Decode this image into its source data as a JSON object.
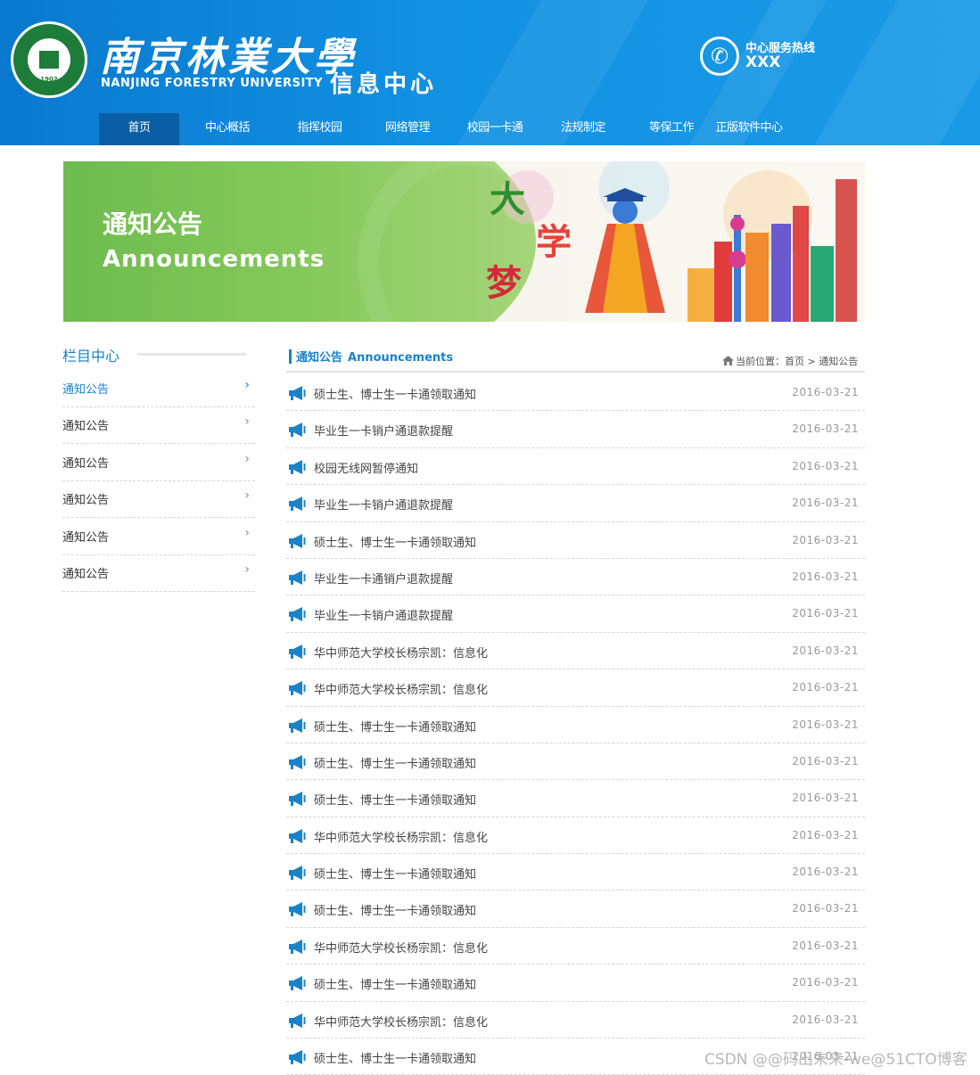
{
  "header": {
    "university_cn": "南京林業大學",
    "university_en": "NANJING FORESTRY UNIVERSITY",
    "seal_year": "1902",
    "center_title": "信息中心",
    "hotline_label": "中心服务热线",
    "hotline_number": "XXX",
    "brand_color": "#0a79cf"
  },
  "nav": {
    "items": [
      {
        "label": "首页",
        "active": true
      },
      {
        "label": "中心概括"
      },
      {
        "label": "指挥校园"
      },
      {
        "label": "网络管理"
      },
      {
        "label": "校园一卡通"
      },
      {
        "label": "法规制定"
      },
      {
        "label": "等保工作"
      },
      {
        "label": "正版软件中心"
      }
    ]
  },
  "banner": {
    "title": "通知公告",
    "subtitle": "Announcements",
    "art_text": [
      "大",
      "学",
      "梦"
    ]
  },
  "sidebar": {
    "title": "栏目中心",
    "items": [
      {
        "label": "通知公告",
        "active": true
      },
      {
        "label": "通知公告"
      },
      {
        "label": "通知公告"
      },
      {
        "label": "通知公告"
      },
      {
        "label": "通知公告"
      },
      {
        "label": "通知公告"
      }
    ],
    "chevron": "›"
  },
  "main": {
    "section_title": "通知公告",
    "section_title_en": "Announcements",
    "breadcrumb": "当前位置：首页 > 通知公告",
    "items": [
      {
        "title": "硕士生、博士生一卡通领取通知",
        "date": "2016-03-21"
      },
      {
        "title": "毕业生一卡销户通退款提醒",
        "date": "2016-03-21"
      },
      {
        "title": "校园无线网暂停通知",
        "date": "2016-03-21"
      },
      {
        "title": "毕业生一卡销户通退款提醒",
        "date": "2016-03-21"
      },
      {
        "title": "硕士生、博士生一卡通领取通知",
        "date": "2016-03-21"
      },
      {
        "title": "毕业生一卡通销户退款提醒",
        "date": "2016-03-21"
      },
      {
        "title": "毕业生一卡销户通退款提醒",
        "date": "2016-03-21"
      },
      {
        "title": "华中师范大学校长杨宗凯：信息化",
        "date": "2016-03-21"
      },
      {
        "title": "华中师范大学校长杨宗凯：信息化",
        "date": "2016-03-21"
      },
      {
        "title": "硕士生、博士生一卡通领取通知",
        "date": "2016-03-21"
      },
      {
        "title": "硕士生、博士生一卡通领取通知",
        "date": "2016-03-21"
      },
      {
        "title": "硕士生、博士生一卡通领取通知",
        "date": "2016-03-21"
      },
      {
        "title": "华中师范大学校长杨宗凯：信息化",
        "date": "2016-03-21"
      },
      {
        "title": "硕士生、博士生一卡通领取通知",
        "date": "2016-03-21"
      },
      {
        "title": "硕士生、博士生一卡通领取通知",
        "date": "2016-03-21"
      },
      {
        "title": "华中师范大学校长杨宗凯：信息化",
        "date": "2016-03-21"
      },
      {
        "title": "硕士生、博士生一卡通领取通知",
        "date": "2016-03-21"
      },
      {
        "title": "华中师范大学校长杨宗凯：信息化",
        "date": "2016-03-21"
      },
      {
        "title": "硕士生、博士生一卡通领取通知",
        "date": "2016-03-21"
      }
    ]
  },
  "watermark": "CSDN @@码出未来-we@51CTO博客"
}
